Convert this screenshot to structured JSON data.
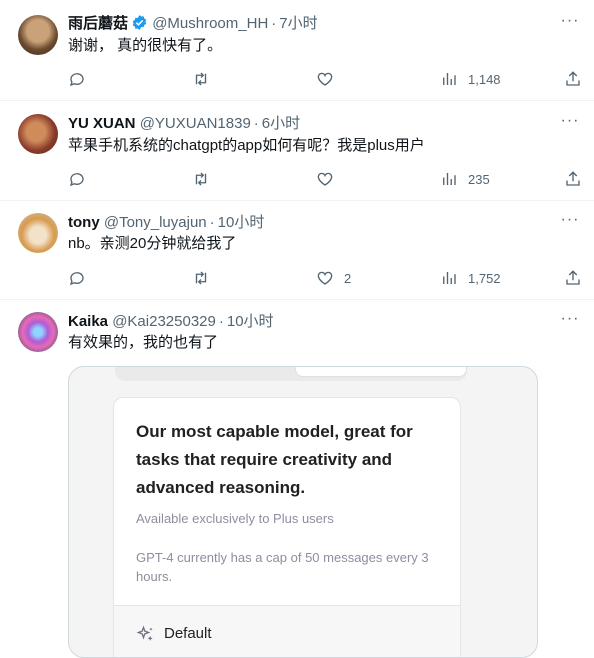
{
  "tweets": [
    {
      "name": "雨后蘑菇",
      "handle": "@Mushroom_HH",
      "dot": "·",
      "time": "7小时",
      "text": "谢谢， 真的很快有了。",
      "verified": true,
      "stats": {
        "replies": "",
        "retweets": "",
        "likes": "",
        "views": "1,148"
      }
    },
    {
      "name": "YU XUAN",
      "handle": "@YUXUAN1839",
      "dot": "·",
      "time": "6小时",
      "text": "苹果手机系统的chatgpt的app如何有呢？我是plus用户",
      "verified": false,
      "stats": {
        "replies": "",
        "retweets": "",
        "likes": "",
        "views": "235"
      }
    },
    {
      "name": "tony",
      "handle": "@Tony_luyajun",
      "dot": "·",
      "time": "10小时",
      "text": "nb。亲测20分钟就给我了",
      "verified": false,
      "stats": {
        "replies": "",
        "retweets": "",
        "likes": "2",
        "views": "1,752"
      }
    },
    {
      "name": "Kaika",
      "handle": "@Kai23250329",
      "dot": "·",
      "time": "10小时",
      "text": "有效果的，我的也有了",
      "verified": false
    }
  ],
  "media": {
    "title": "Our most capable model, great for tasks that require creativity and advanced reasoning.",
    "subtitle": "Available exclusively to Plus users",
    "note": "GPT-4 currently has a cap of 50 messages every 3 hours.",
    "footer_label": "Default"
  },
  "icons": {
    "more": "more-icon",
    "reply": "reply-icon",
    "retweet": "retweet-icon",
    "like": "heart-icon",
    "views": "views-icon",
    "share": "share-icon",
    "verified": "verified-badge-icon",
    "sparkle": "sparkle-icon"
  },
  "colors": {
    "text": "#0f1419",
    "secondary": "#536471",
    "verified": "#1d9bf0",
    "border": "#eff3f4"
  }
}
